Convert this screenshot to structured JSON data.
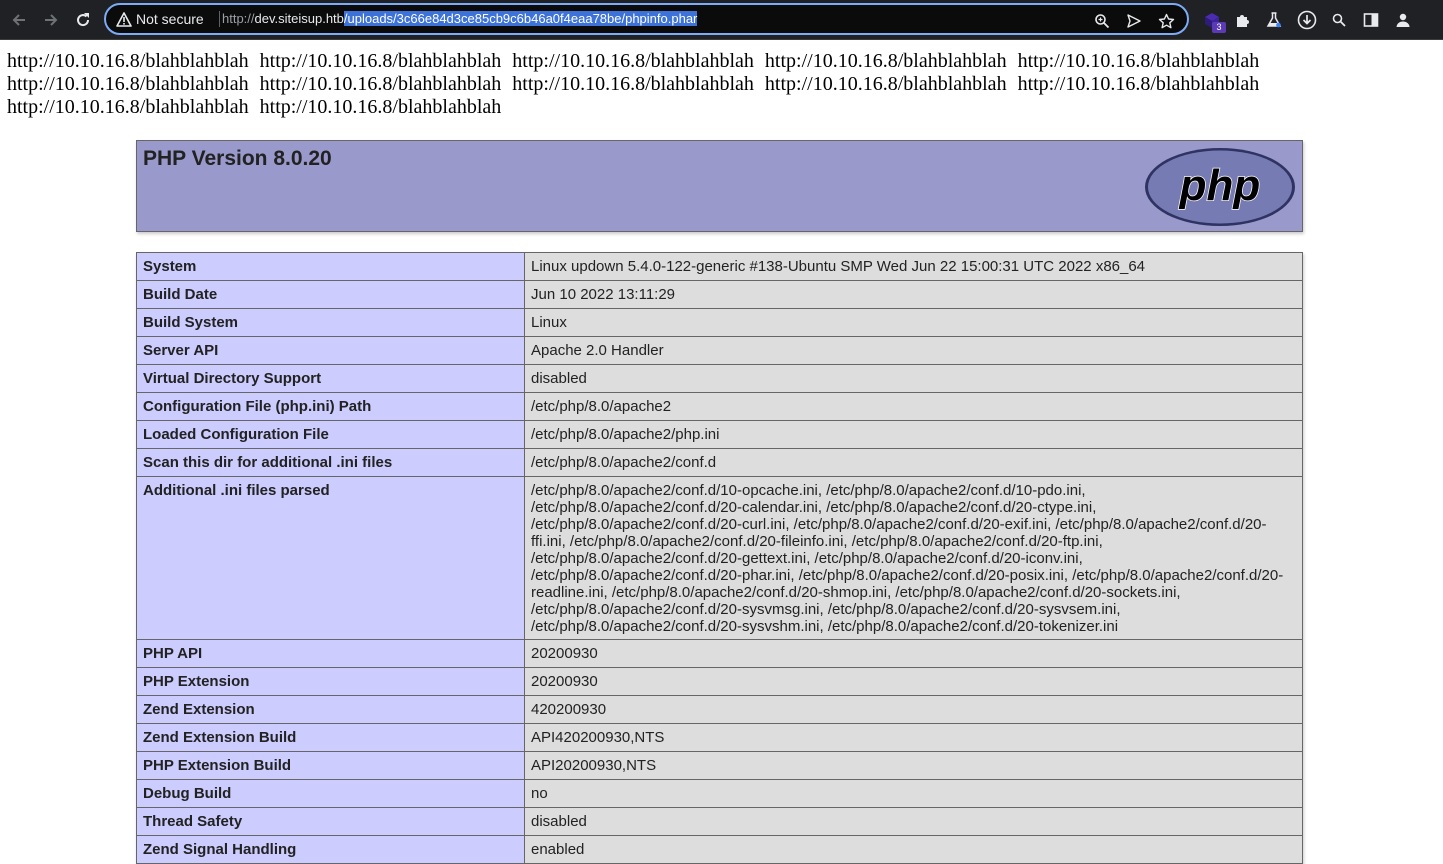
{
  "browser": {
    "security_label": "Not secure",
    "url_scheme": "http://",
    "url_host": "dev.siteisup.htb",
    "url_path": "/uploads/3c66e84d3ce85cb9c6b46a0f4eaa78be/phpinfo.phar",
    "extension_badge": "3"
  },
  "page": {
    "links": [
      "http://10.10.16.8/blahblahblah",
      "http://10.10.16.8/blahblahblah",
      "http://10.10.16.8/blahblahblah",
      "http://10.10.16.8/blahblahblah",
      "http://10.10.16.8/blahblahblah",
      "http://10.10.16.8/blahblahblah",
      "http://10.10.16.8/blahblahblah",
      "http://10.10.16.8/blahblahblah",
      "http://10.10.16.8/blahblahblah",
      "http://10.10.16.8/blahblahblah",
      "http://10.10.16.8/blahblahblah",
      "http://10.10.16.8/blahblahblah"
    ],
    "php_title": "PHP Version 8.0.20",
    "logo_text": "php",
    "rows": [
      {
        "label": "System",
        "value": "Linux updown 5.4.0-122-generic #138-Ubuntu SMP Wed Jun 22 15:00:31 UTC 2022 x86_64"
      },
      {
        "label": "Build Date",
        "value": "Jun 10 2022 13:11:29"
      },
      {
        "label": "Build System",
        "value": "Linux"
      },
      {
        "label": "Server API",
        "value": "Apache 2.0 Handler"
      },
      {
        "label": "Virtual Directory Support",
        "value": "disabled"
      },
      {
        "label": "Configuration File (php.ini) Path",
        "value": "/etc/php/8.0/apache2"
      },
      {
        "label": "Loaded Configuration File",
        "value": "/etc/php/8.0/apache2/php.ini"
      },
      {
        "label": "Scan this dir for additional .ini files",
        "value": "/etc/php/8.0/apache2/conf.d"
      },
      {
        "label": "Additional .ini files parsed",
        "value": "/etc/php/8.0/apache2/conf.d/10-opcache.ini, /etc/php/8.0/apache2/conf.d/10-pdo.ini, /etc/php/8.0/apache2/conf.d/20-calendar.ini, /etc/php/8.0/apache2/conf.d/20-ctype.ini, /etc/php/8.0/apache2/conf.d/20-curl.ini, /etc/php/8.0/apache2/conf.d/20-exif.ini, /etc/php/8.0/apache2/conf.d/20-ffi.ini, /etc/php/8.0/apache2/conf.d/20-fileinfo.ini, /etc/php/8.0/apache2/conf.d/20-ftp.ini, /etc/php/8.0/apache2/conf.d/20-gettext.ini, /etc/php/8.0/apache2/conf.d/20-iconv.ini, /etc/php/8.0/apache2/conf.d/20-phar.ini, /etc/php/8.0/apache2/conf.d/20-posix.ini, /etc/php/8.0/apache2/conf.d/20-readline.ini, /etc/php/8.0/apache2/conf.d/20-shmop.ini, /etc/php/8.0/apache2/conf.d/20-sockets.ini, /etc/php/8.0/apache2/conf.d/20-sysvmsg.ini, /etc/php/8.0/apache2/conf.d/20-sysvsem.ini, /etc/php/8.0/apache2/conf.d/20-sysvshm.ini, /etc/php/8.0/apache2/conf.d/20-tokenizer.ini"
      },
      {
        "label": "PHP API",
        "value": "20200930"
      },
      {
        "label": "PHP Extension",
        "value": "20200930"
      },
      {
        "label": "Zend Extension",
        "value": "420200930"
      },
      {
        "label": "Zend Extension Build",
        "value": "API420200930,NTS"
      },
      {
        "label": "PHP Extension Build",
        "value": "API20200930,NTS"
      },
      {
        "label": "Debug Build",
        "value": "no"
      },
      {
        "label": "Thread Safety",
        "value": "disabled"
      },
      {
        "label": "Zend Signal Handling",
        "value": "enabled"
      }
    ]
  },
  "colors": {
    "toolbar_bg": "#202124",
    "omnibox_border": "#7cacf8",
    "url_selection": "#3d72d8",
    "php_header": "#9999cc",
    "label_cell": "#ccccff",
    "value_cell": "#dddddd"
  },
  "icons": [
    "back-arrow-icon",
    "forward-arrow-icon",
    "reload-icon",
    "warning-triangle-icon",
    "zoom-icon",
    "send-icon",
    "star-icon",
    "extension-cube-icon",
    "puzzle-icon",
    "flask-icon",
    "download-icon",
    "search-icon",
    "side-panel-icon",
    "profile-icon"
  ]
}
